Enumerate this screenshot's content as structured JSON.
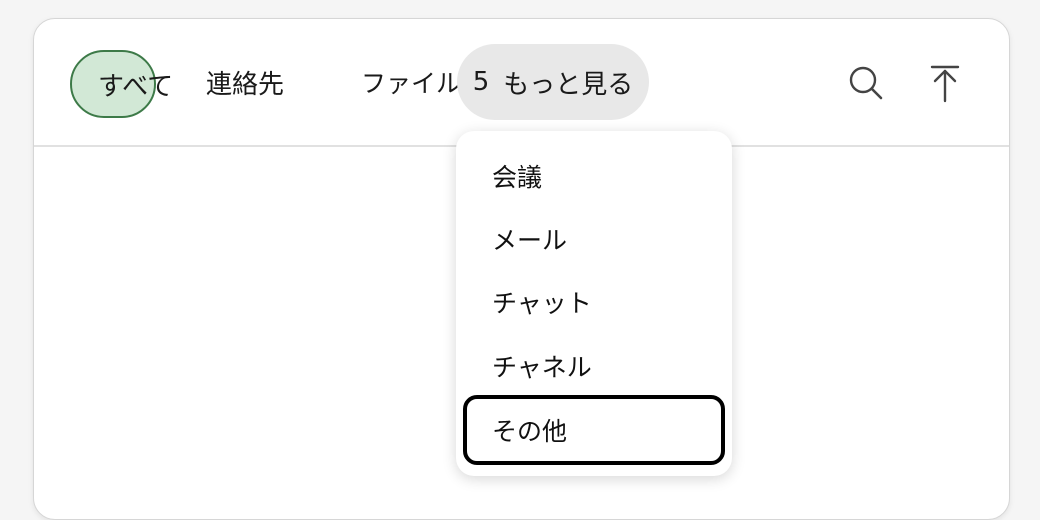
{
  "tabs": {
    "all": "すべて",
    "contacts": "連絡先",
    "files": "ファイル",
    "more_count": "5",
    "more_label": "もっと見る"
  },
  "icons": {
    "search": "search-icon",
    "upload": "arrow-up-to-line-icon"
  },
  "dropdown": {
    "items": [
      {
        "label": "会議"
      },
      {
        "label": "メール"
      },
      {
        "label": "チャット"
      },
      {
        "label": "チャネル"
      },
      {
        "label": "その他"
      }
    ],
    "focused_index": 4
  },
  "colors": {
    "selected_fill": "#d2e8d6",
    "selected_border": "#3d7a48",
    "more_fill": "#e8e8e8",
    "focus_ring": "#000000"
  }
}
